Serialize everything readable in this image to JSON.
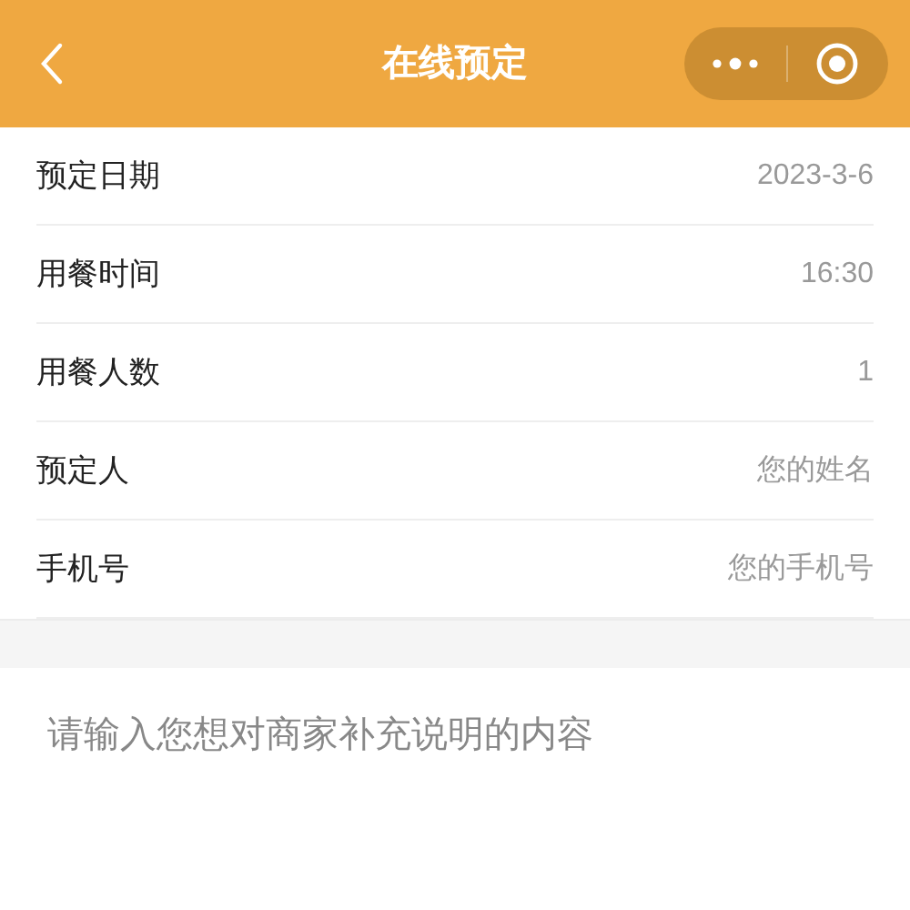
{
  "header": {
    "title": "在线预定"
  },
  "form_rows": [
    {
      "label": "预定日期",
      "value": "2023-3-6"
    },
    {
      "label": "用餐时间",
      "value": "16:30"
    },
    {
      "label": "用餐人数",
      "value": "1"
    },
    {
      "label": "预定人",
      "placeholder": "您的姓名"
    },
    {
      "label": "手机号",
      "placeholder": "您的手机号"
    }
  ],
  "remarks": {
    "placeholder": "请输入您想对商家补充说明的内容"
  }
}
